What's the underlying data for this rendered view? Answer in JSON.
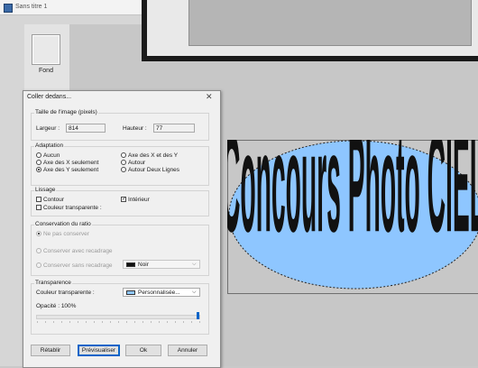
{
  "app": {
    "doc_title": "Sans titre 1",
    "layer_label": "Fond"
  },
  "artwork": {
    "text": "Concours Photo CIEL",
    "fill_color": "#8ec6ff",
    "text_color": "#111111"
  },
  "dialog": {
    "title": "Coller dedans...",
    "close_glyph": "✕",
    "size_group": {
      "legend": "Taille de l'image (pixels)",
      "width_label": "Largeur :",
      "width_value": "814",
      "height_label": "Hauteur :",
      "height_value": "77"
    },
    "fit_group": {
      "legend": "Adaptation",
      "options": [
        {
          "label": "Aucun",
          "selected": false
        },
        {
          "label": "Axe des X seulement",
          "selected": false
        },
        {
          "label": "Axe des Y seulement",
          "selected": true
        },
        {
          "label": "Axe des X et des Y",
          "selected": false
        },
        {
          "label": "Autour",
          "selected": false
        },
        {
          "label": "Autour Deux Lignes",
          "selected": false
        }
      ]
    },
    "smooth_group": {
      "legend": "Lissage",
      "contour_label": "Contour",
      "contour_checked": false,
      "interior_label": "Intérieur",
      "interior_checked": true,
      "transparent_label": "Couleur transparente :",
      "transparent_checked": false
    },
    "ratio_group": {
      "legend": "Conservation du ratio",
      "options": [
        {
          "label": "Ne pas conserver",
          "selected": true,
          "enabled": false
        },
        {
          "label": "Conserver avec recadrage",
          "selected": false,
          "enabled": false
        },
        {
          "label": "Conserver sans recadrage",
          "selected": false,
          "enabled": false
        }
      ],
      "color_value": "Noir",
      "color_swatch": "#111111"
    },
    "transparency_group": {
      "legend": "Transparence",
      "color_label": "Couleur transparente :",
      "color_value": "Personnalisée...",
      "color_swatch": "#8ec6ff",
      "opacity_label": "Opacité : 100%",
      "opacity": 1.0
    },
    "buttons": {
      "reset": "Rétablir",
      "preview": "Prévisualiser",
      "ok": "Ok",
      "cancel": "Annuler"
    }
  }
}
